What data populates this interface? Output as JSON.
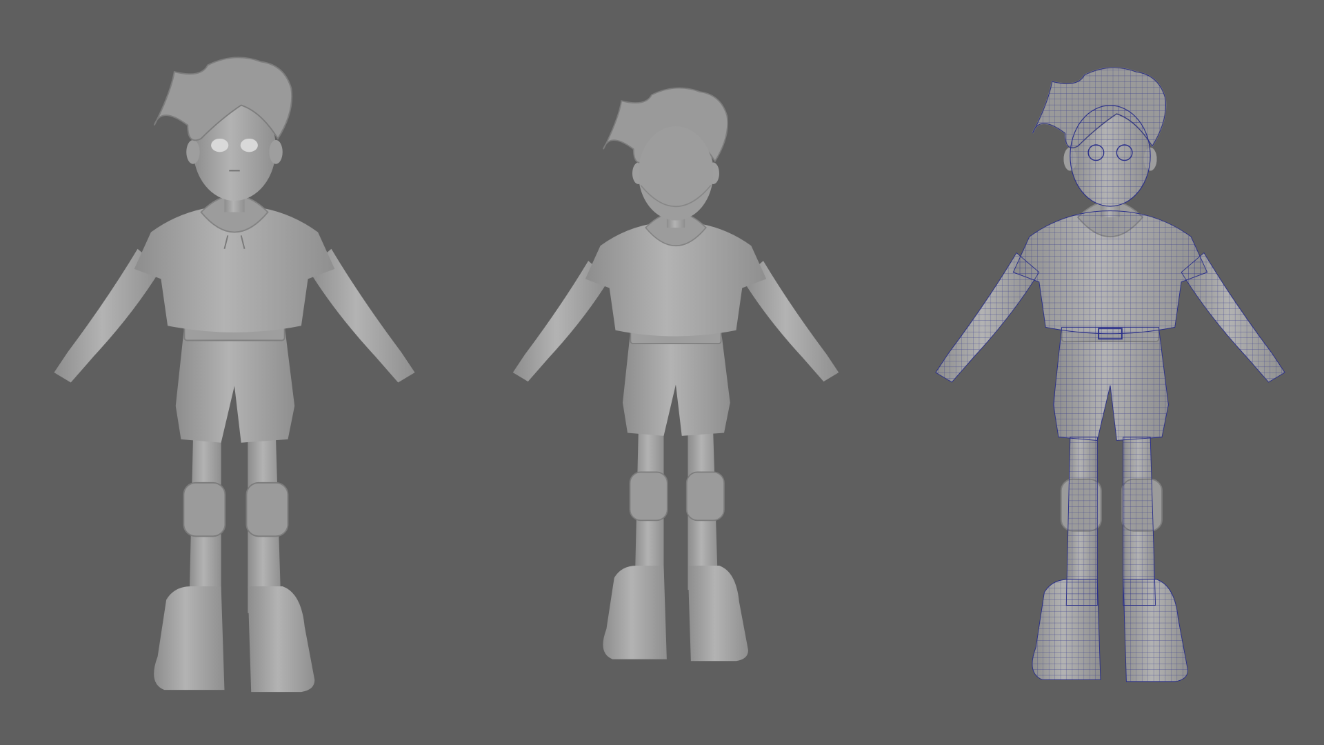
{
  "scene": {
    "background_color": "#5f5f5f",
    "model_color": "#a9a9a9",
    "model_shadow_color": "#8c8c8c",
    "wireframe_color": "#2a2f8a",
    "views": [
      {
        "view": "front"
      },
      {
        "view": "back"
      },
      {
        "view": "front-wireframe"
      }
    ]
  }
}
